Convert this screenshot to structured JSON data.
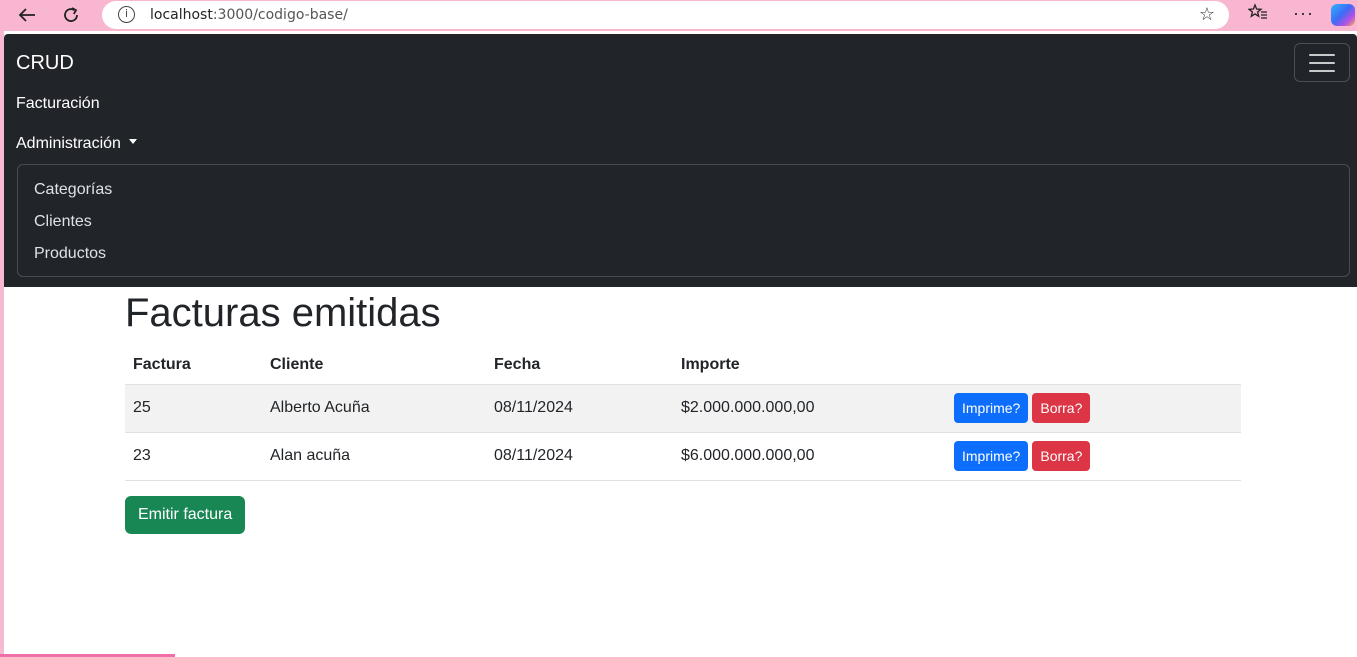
{
  "browser": {
    "url_host": "localhost",
    "url_path": ":3000/codigo-base/",
    "back_icon": "arrow-left-icon",
    "reload_icon": "reload-icon"
  },
  "navbar": {
    "brand": "CRUD",
    "links": {
      "facturacion": "Facturación",
      "administracion": "Administración"
    },
    "dropdown": {
      "items": [
        "Categorías",
        "Clientes",
        "Productos"
      ]
    }
  },
  "page": {
    "title": "Facturas emitidas",
    "table": {
      "headers": [
        "Factura",
        "Cliente",
        "Fecha",
        "Importe",
        ""
      ],
      "rows": [
        {
          "factura": "25",
          "cliente": "Alberto Acuña",
          "fecha": "08/11/2024",
          "importe": "$2.000.000.000,00",
          "print_label": "Imprime?",
          "delete_label": "Borra?"
        },
        {
          "factura": "23",
          "cliente": "Alan acuña",
          "fecha": "08/11/2024",
          "importe": "$6.000.000.000,00",
          "print_label": "Imprime?",
          "delete_label": "Borra?"
        }
      ]
    },
    "emit_button": "Emitir factura"
  },
  "colors": {
    "navbar_bg": "#212529",
    "primary": "#0d6efd",
    "danger": "#dc3545",
    "success": "#198754"
  }
}
